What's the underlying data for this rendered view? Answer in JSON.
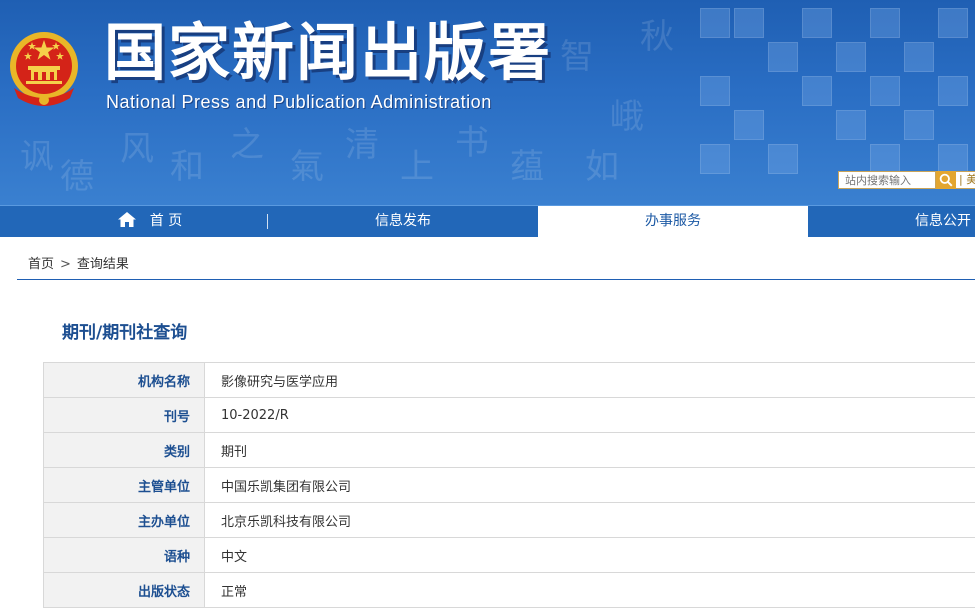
{
  "header": {
    "title_cn": "国家新闻出版署",
    "title_en": "National Press and Publication Administration",
    "emblem_icon": "national-emblem-icon",
    "search": {
      "placeholder": "站内搜索输入",
      "icon": "search-icon",
      "trailing_text": "| 美"
    },
    "colors": {
      "banner": "#2a6ec4",
      "search_button": "#e3a630"
    }
  },
  "nav": {
    "items": [
      {
        "label": "首 页",
        "icon": "home-icon"
      },
      {
        "label": "信息发布"
      },
      {
        "label": "办事服务",
        "active": true
      },
      {
        "label": "信息公开"
      }
    ]
  },
  "breadcrumb": {
    "home": "首页",
    "separator": ">",
    "current": "查询结果"
  },
  "section": {
    "title": "期刊/期刊社查询"
  },
  "table": {
    "rows": [
      {
        "key": "机构名称",
        "value": "影像研究与医学应用"
      },
      {
        "key": "刊号",
        "value": "10-2022/R"
      },
      {
        "key": "类别",
        "value": "期刊"
      },
      {
        "key": "主管单位",
        "value": "中国乐凯集团有限公司"
      },
      {
        "key": "主办单位",
        "value": "北京乐凯科技有限公司"
      },
      {
        "key": "语种",
        "value": "中文"
      },
      {
        "key": "出版状态",
        "value": "正常"
      }
    ]
  }
}
